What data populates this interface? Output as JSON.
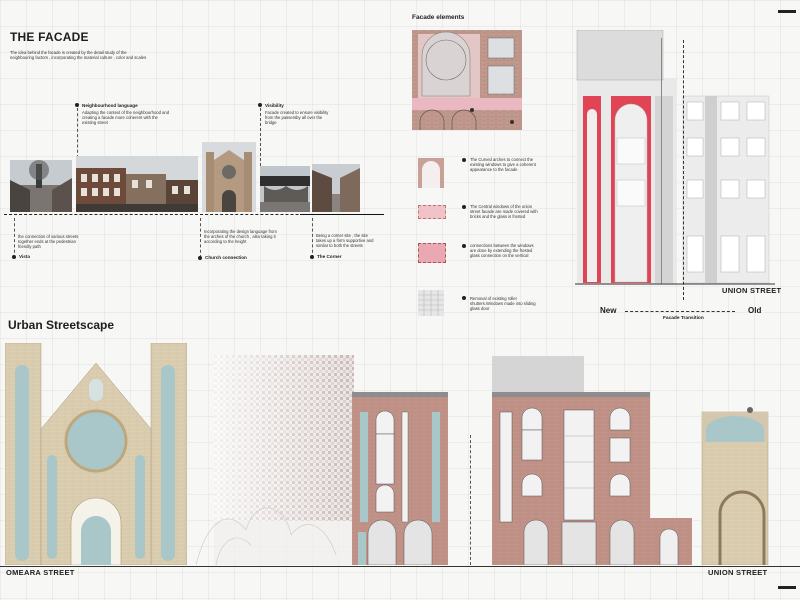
{
  "facade": {
    "title": "THE FACADE",
    "intro": "The idea behind the facade is created by the detail study of the neighbouring factors , incorporating the material culture , color and scales",
    "notes_top": [
      {
        "heading": "Neighbourhood language",
        "text": "Adapting the context of the neighbourhood and creating a facade more coherent with the existing street"
      },
      {
        "heading": "Visibility",
        "text": "Facade created to ensure visibility from the passersby all over the bridge"
      }
    ],
    "notes_bottom": [
      {
        "heading": "Vista",
        "text": "the connection of various streets together ends at the pedestrian friendly path"
      },
      {
        "heading": "Church connection",
        "text": "Incorporating the design language from the arches of the church , also taking it according to the height"
      },
      {
        "heading": "The Corner",
        "text": "Being a corner site , the site takes up a form supportive and similar to both the streets"
      }
    ]
  },
  "elements": {
    "title": "Facade elements",
    "items": [
      {
        "num": "1",
        "text": "The Curved arches to connect the existing windows to give a coherent appearance to the facade"
      },
      {
        "num": "2",
        "text": "The Central windows of the union street facade are made covered with bricks and the glass is frosted"
      },
      {
        "num": "3",
        "text": "connections between the windows are done by extending the frosted glass connection on the vertical"
      },
      {
        "num": "4",
        "text": "Removal of existing roller shutters.Windows made into sliding glass door"
      }
    ]
  },
  "transition": {
    "street": "UNION STREET",
    "new_label": "New",
    "old_label": "Old",
    "caption": "Facade Transition"
  },
  "streetscape": {
    "title": "Urban Streetscape",
    "left_street": "OMEARA STREET",
    "right_street": "UNION STREET"
  },
  "colors": {
    "brick": "#b88a7e",
    "accent_red": "#e04455",
    "pink": "#f0b8c0",
    "stone": "#d8c9a8",
    "glass": "#a9c7c9"
  }
}
